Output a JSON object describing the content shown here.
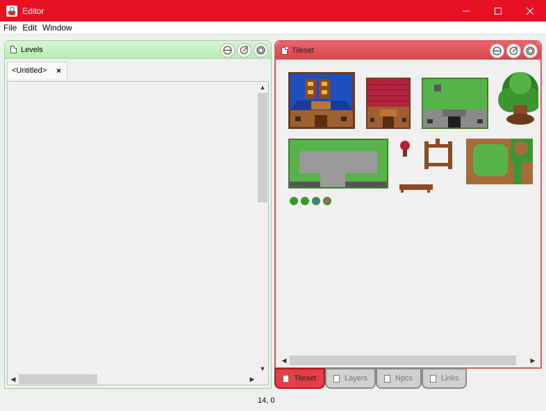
{
  "window": {
    "title": "Editor"
  },
  "menu": {
    "items": [
      "File",
      "Edit",
      "Window"
    ]
  },
  "levels_panel": {
    "title": "Levels",
    "tab_label": "<Untitled>",
    "tab_close": "×"
  },
  "tileset_panel": {
    "title": "Tileset"
  },
  "bottom_tabs": [
    "Tileset",
    "Layers",
    "Npcs",
    "Links"
  ],
  "status": {
    "coords": "14, 0"
  },
  "colors": {
    "titlebar": "#e81123",
    "levels_header": "#c3f0be",
    "tileset_header": "#e0545c"
  }
}
